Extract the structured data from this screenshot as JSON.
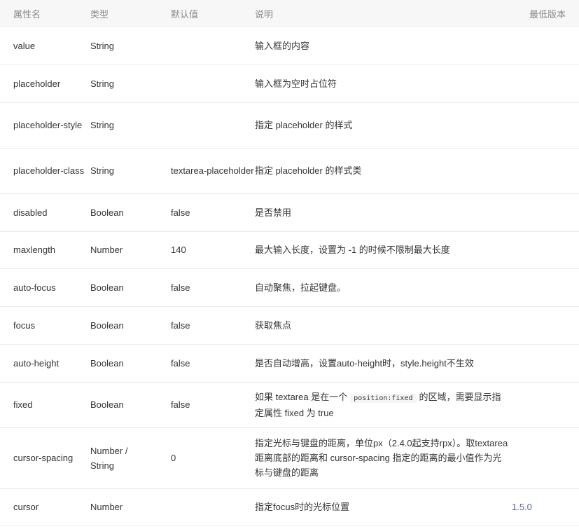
{
  "headers": {
    "name": "属性名",
    "type": "类型",
    "default": "默认值",
    "desc": "说明",
    "version": "最低版本"
  },
  "rows": [
    {
      "name": "value",
      "type": "String",
      "default": "",
      "desc": "输入框的内容",
      "version": ""
    },
    {
      "name": "placeholder",
      "type": "String",
      "default": "",
      "desc": "输入框为空时占位符",
      "version": ""
    },
    {
      "name": "placeholder-style",
      "type": "String",
      "default": "",
      "desc": "指定 placeholder 的样式",
      "version": ""
    },
    {
      "name": "placeholder-class",
      "type": "String",
      "default": "textarea-placeholder",
      "desc": "指定 placeholder 的样式类",
      "version": ""
    },
    {
      "name": "disabled",
      "type": "Boolean",
      "default": "false",
      "desc": "是否禁用",
      "version": ""
    },
    {
      "name": "maxlength",
      "type": "Number",
      "default": "140",
      "desc": "最大输入长度，设置为 -1 的时候不限制最大长度",
      "version": ""
    },
    {
      "name": "auto-focus",
      "type": "Boolean",
      "default": "false",
      "desc": "自动聚焦，拉起键盘。",
      "version": ""
    },
    {
      "name": "focus",
      "type": "Boolean",
      "default": "false",
      "desc": "获取焦点",
      "version": ""
    },
    {
      "name": "auto-height",
      "type": "Boolean",
      "default": "false",
      "desc": "是否自动增高，设置auto-height时，style.height不生效",
      "version": ""
    },
    {
      "name": "fixed",
      "type": "Boolean",
      "default": "false",
      "desc_prefix": "如果 textarea 是在一个",
      "desc_code": "position:fixed",
      "desc_suffix": "的区域，需要显示指定属性 fixed 为 true",
      "version": ""
    },
    {
      "name": "cursor-spacing",
      "type": "Number / String",
      "default": "0",
      "desc": "指定光标与键盘的距离，单位px（2.4.0起支持rpx）。取textarea 距离底部的距离和 cursor-spacing 指定的距离的最小值作为光标与键盘的距离",
      "version": ""
    },
    {
      "name": "cursor",
      "type": "Number",
      "default": "",
      "desc": "指定focus时的光标位置",
      "version": "1.5.0"
    }
  ]
}
